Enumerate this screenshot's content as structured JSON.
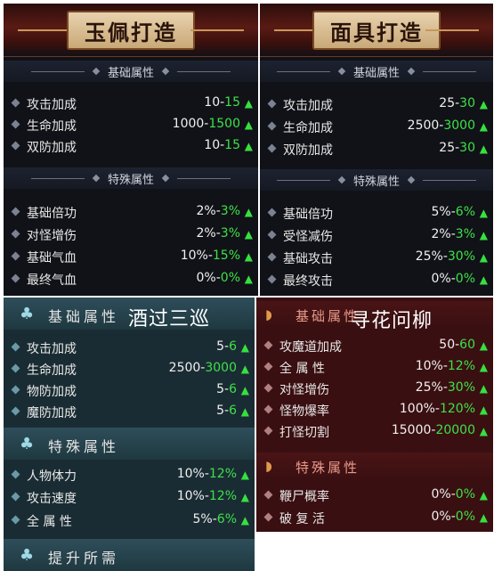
{
  "panel_jade": {
    "banner_title": "玉佩打造",
    "basic_header": "基础属性",
    "basic_rows": [
      {
        "label": "攻击加成",
        "base": "10-",
        "high": "15"
      },
      {
        "label": "生命加成",
        "base": "1000-",
        "high": "1500"
      },
      {
        "label": "双防加成",
        "base": "10-",
        "high": "15"
      }
    ],
    "special_header": "特殊属性",
    "special_rows": [
      {
        "label": "基础倍功",
        "base": "2%-",
        "high": "3%"
      },
      {
        "label": "对怪增伤",
        "base": "2%-",
        "high": "3%"
      },
      {
        "label": "基础气血",
        "base": "10%-",
        "high": "15%"
      },
      {
        "label": "最终气血",
        "base": "0%-",
        "high": "0%"
      }
    ]
  },
  "panel_mask": {
    "banner_title": "面具打造",
    "basic_header": "基础属性",
    "basic_rows": [
      {
        "label": "攻击加成",
        "base": "25-",
        "high": "30"
      },
      {
        "label": "生命加成",
        "base": "2500-",
        "high": "3000"
      },
      {
        "label": "双防加成",
        "base": "25-",
        "high": "30"
      }
    ],
    "special_header": "特殊属性",
    "special_rows": [
      {
        "label": "基础倍功",
        "base": "5%-",
        "high": "6%"
      },
      {
        "label": "受怪减伤",
        "base": "2%-",
        "high": "3%"
      },
      {
        "label": "基础攻击",
        "base": "25%-",
        "high": "30%"
      },
      {
        "label": "最终攻击",
        "base": "0%-",
        "high": "0%"
      }
    ]
  },
  "panel_wine": {
    "overlay_title": "酒过三巡",
    "basic_header": "基础属性",
    "basic_rows": [
      {
        "label": "攻击加成",
        "base": "5-",
        "high": "6"
      },
      {
        "label": "生命加成",
        "base": "2500-",
        "high": "3000"
      },
      {
        "label": "物防加成",
        "base": "5-",
        "high": "6"
      },
      {
        "label": "魔防加成",
        "base": "5-",
        "high": "6"
      }
    ],
    "special_header": "特殊属性",
    "special_rows": [
      {
        "label": "人物体力",
        "base": "10%-",
        "high": "12%"
      },
      {
        "label": "攻击速度",
        "base": "10%-",
        "high": "12%"
      },
      {
        "label": "全 属 性",
        "base": "5%-",
        "high": "6%"
      }
    ],
    "upgrade_header": "提升所需"
  },
  "panel_flower": {
    "overlay_title": "寻花问柳",
    "basic_header": "基础属性",
    "basic_rows": [
      {
        "label": "攻魔道加成",
        "base": "50-",
        "high": "60"
      },
      {
        "label": "全 属 性",
        "base": "10%-",
        "high": "12%"
      },
      {
        "label": "对怪增伤",
        "base": "25%-",
        "high": "30%"
      },
      {
        "label": "怪物爆率",
        "base": "100%-",
        "high": "120%"
      },
      {
        "label": "打怪切割",
        "base": "15000-",
        "high": "20000"
      }
    ],
    "special_header": "特殊属性",
    "special_rows": [
      {
        "label": "鞭尸概率",
        "base": "0%-",
        "high": "0%"
      },
      {
        "label": "破 复 活",
        "base": "0%-",
        "high": "0%"
      }
    ]
  },
  "icons": {
    "row_marker": "diamond-bullet-icon",
    "increase": "up-arrow-icon",
    "section_mark": "cloud-emblem-icon",
    "fan": "fan-icon"
  },
  "colors": {
    "highlight_green": "#3ee04a",
    "arrow_green": "#36e040",
    "banner_red": "#5a1a14",
    "teal_bg": "#1a2c33",
    "red_bg": "#3a0f11"
  }
}
